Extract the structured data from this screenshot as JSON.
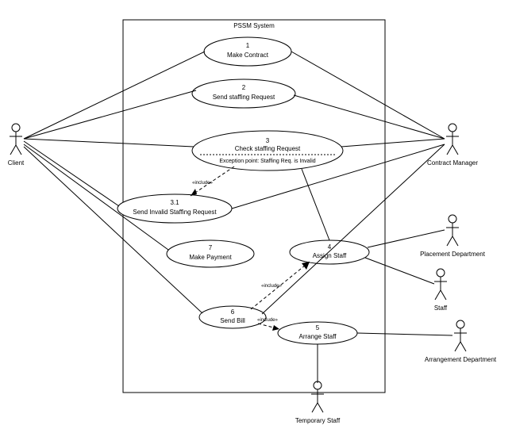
{
  "system": {
    "title": "PSSM System"
  },
  "actors": {
    "client": "Client",
    "contract_manager": "Contract Manager",
    "placement_department": "Placement Department",
    "staff": "Staff",
    "arrangement_department": "Arrangement Department",
    "temporary_staff": "Temporary Staff"
  },
  "usecases": {
    "uc1": {
      "num": "1",
      "name": "Make Contract"
    },
    "uc2": {
      "num": "2",
      "name": "Send staffing Request"
    },
    "uc3": {
      "num": "3",
      "name": "Check  staffing Request",
      "exception": "Exception point: Staffing Req. is Invalid"
    },
    "uc3_1": {
      "num": "3.1",
      "name": "Send Invalid Staffing Request"
    },
    "uc4": {
      "num": "4",
      "name": "Assign Staff"
    },
    "uc5": {
      "num": "5",
      "name": "Arrange Staff"
    },
    "uc6": {
      "num": "6",
      "name": "Send Bill"
    },
    "uc7": {
      "num": "7",
      "name": "Make Payment"
    },
    "include_label": "«include»"
  }
}
